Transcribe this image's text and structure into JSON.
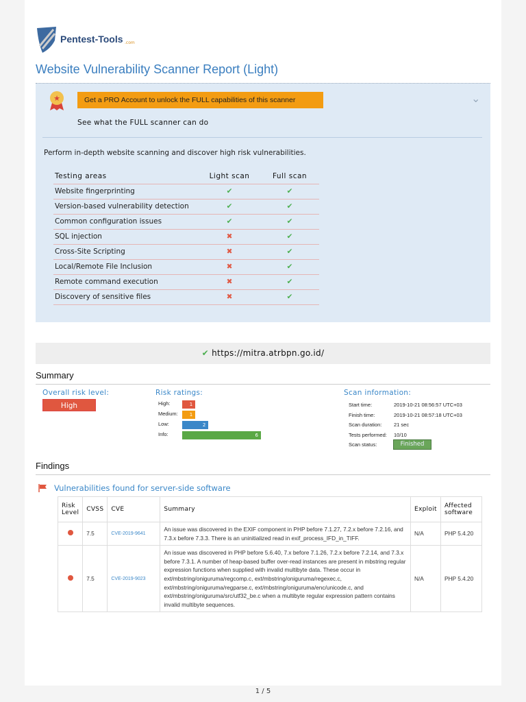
{
  "logo": {
    "text": "Pentest-Tools",
    "suffix": ".com"
  },
  "title": "Website Vulnerability Scanner Report (Light)",
  "promo": {
    "button": "Get a PRO Account to unlock the FULL capabilities of this scanner",
    "subtitle": "See what the FULL scanner can do",
    "description": "Perform in-depth website scanning and discover high risk vulnerabilities.",
    "headers": [
      "Testing areas",
      "Light scan",
      "Full scan"
    ],
    "rows": [
      {
        "area": "Website fingerprinting",
        "light": true,
        "full": true
      },
      {
        "area": "Version-based vulnerability detection",
        "light": true,
        "full": true
      },
      {
        "area": "Common configuration issues",
        "light": true,
        "full": true
      },
      {
        "area": "SQL injection",
        "light": false,
        "full": true
      },
      {
        "area": "Cross-Site Scripting",
        "light": false,
        "full": true
      },
      {
        "area": "Local/Remote File Inclusion",
        "light": false,
        "full": true
      },
      {
        "area": "Remote command execution",
        "light": false,
        "full": true
      },
      {
        "area": "Discovery of sensitive files",
        "light": false,
        "full": true
      }
    ]
  },
  "target_url": "https://mitra.atrbpn.go.id/",
  "summary": {
    "heading": "Summary",
    "overall_label": "Overall risk level:",
    "overall_value": "High",
    "ratings_label": "Risk ratings:",
    "ratings": [
      {
        "label": "High:",
        "value": "1",
        "color": "#e0573f"
      },
      {
        "label": "Medium:",
        "value": "1",
        "color": "#f39c12"
      },
      {
        "label": "Low:",
        "value": "2",
        "color": "#3a87c8"
      },
      {
        "label": "Info:",
        "value": "6",
        "color": "#5aa845"
      }
    ],
    "scan_label": "Scan information:",
    "scan": [
      {
        "k": "Start time:",
        "v": "2019-10-21 08:56:57 UTC+03"
      },
      {
        "k": "Finish time:",
        "v": "2019-10-21 08:57:18 UTC+03"
      },
      {
        "k": "Scan duration:",
        "v": "21 sec"
      },
      {
        "k": "Tests performed:",
        "v": "10/10"
      },
      {
        "k": "Scan status:",
        "v": "Finished"
      }
    ]
  },
  "findings": {
    "heading": "Findings",
    "section": "Vulnerabilities found for server-side software",
    "headers": [
      "Risk Level",
      "CVSS",
      "CVE",
      "Summary",
      "Exploit",
      "Affected software"
    ],
    "rows": [
      {
        "cvss": "7.5",
        "cve": "CVE-2019-9641",
        "summary": "An issue was discovered in the EXIF component in PHP before 7.1.27, 7.2.x before 7.2.16, and 7.3.x before 7.3.3. There is an uninitialized read in exif_process_IFD_in_TIFF.",
        "exploit": "N/A",
        "software": "PHP 5.4.20"
      },
      {
        "cvss": "7.5",
        "cve": "CVE-2019-9023",
        "summary": "An issue was discovered in PHP before 5.6.40, 7.x before 7.1.26, 7.2.x before 7.2.14, and 7.3.x before 7.3.1. A number of heap-based buffer over-read instances are present in mbstring regular expression functions when supplied with invalid multibyte data. These occur in ext/mbstring/oniguruma/regcomp.c, ext/mbstring/oniguruma/regexec.c, ext/mbstring/oniguruma/regparse.c, ext/mbstring/oniguruma/enc/unicode.c, and ext/mbstring/oniguruma/src/utf32_be.c when a multibyte regular expression pattern contains invalid multibyte sequences.",
        "exploit": "N/A",
        "software": "PHP 5.4.20"
      }
    ]
  },
  "pager": "1 / 5"
}
